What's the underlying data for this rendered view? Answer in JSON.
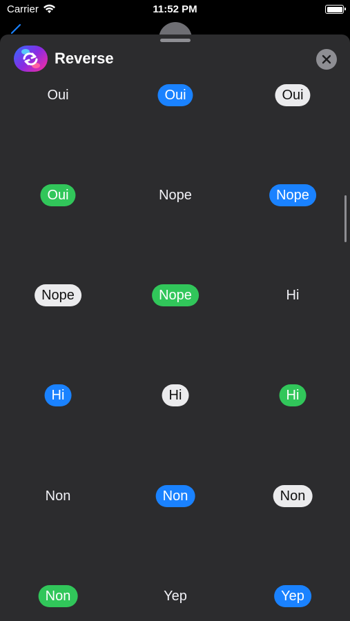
{
  "status_bar": {
    "carrier": "Carrier",
    "time": "11:52 PM"
  },
  "header": {
    "title": "Reverse"
  },
  "bubbles": [
    {
      "label": "Oui",
      "style": "plain"
    },
    {
      "label": "Oui",
      "style": "blue"
    },
    {
      "label": "Oui",
      "style": "white"
    },
    {
      "label": "Oui",
      "style": "green"
    },
    {
      "label": "Nope",
      "style": "plain"
    },
    {
      "label": "Nope",
      "style": "blue"
    },
    {
      "label": "Nope",
      "style": "white"
    },
    {
      "label": "Nope",
      "style": "green"
    },
    {
      "label": "Hi",
      "style": "plain"
    },
    {
      "label": "Hi",
      "style": "blue"
    },
    {
      "label": "Hi",
      "style": "white"
    },
    {
      "label": "Hi",
      "style": "green"
    },
    {
      "label": "Non",
      "style": "plain"
    },
    {
      "label": "Non",
      "style": "blue"
    },
    {
      "label": "Non",
      "style": "white"
    },
    {
      "label": "Non",
      "style": "green"
    },
    {
      "label": "Yep",
      "style": "plain"
    },
    {
      "label": "Yep",
      "style": "blue"
    }
  ],
  "colors": {
    "blue": "#1a82ff",
    "green": "#31c65a",
    "white": "#ebebed",
    "sheet": "#2c2c2e"
  },
  "icons": [
    "wifi-icon",
    "battery-icon",
    "back-chevron-icon",
    "app-icon",
    "close-icon"
  ]
}
